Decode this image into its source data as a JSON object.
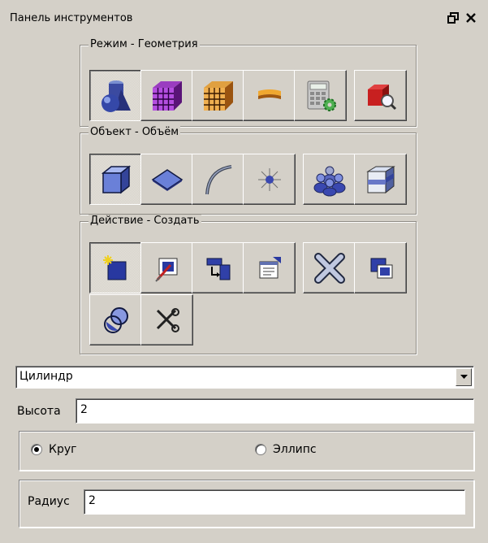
{
  "panel": {
    "title": "Панель инструментов",
    "float_icon": "float-window-icon",
    "close_icon": "close-icon"
  },
  "groups": {
    "mode": {
      "legend": "Режим - Геометрия",
      "buttons": [
        "geometry-mode-icon",
        "mesh-mode-icon",
        "block-mode-icon",
        "boundary-mode-icon",
        "calculator-settings-icon",
        "inspect-volume-icon"
      ],
      "active_index": 0
    },
    "object": {
      "legend": "Объект - Объём",
      "buttons": [
        "volume-icon",
        "face-icon",
        "edge-icon",
        "vertex-icon",
        "group-icon",
        "body-icon"
      ],
      "active_index": 0
    },
    "action": {
      "legend": "Действие - Создать",
      "buttons": [
        "create-icon",
        "modify-icon",
        "transform-icon",
        "properties-icon",
        "delete-icon",
        "copy-icon",
        "boolean-icon",
        "split-icon"
      ],
      "active_index": 0
    }
  },
  "shape_select": {
    "value": "Цилиндр"
  },
  "height": {
    "label": "Высота",
    "value": "2"
  },
  "section": {
    "option_circle": "Круг",
    "option_ellipse": "Эллипс",
    "selected": "Круг"
  },
  "radius": {
    "label": "Радиус",
    "value": "2"
  }
}
